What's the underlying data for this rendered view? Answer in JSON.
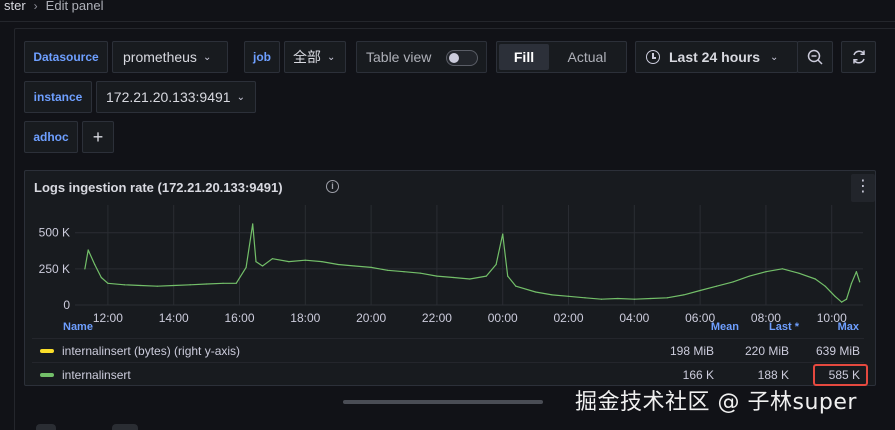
{
  "breadcrumb": {
    "parent": "ster",
    "separator": "›",
    "current": "Edit panel"
  },
  "variables": {
    "datasource": {
      "label": "Datasource",
      "value": "prometheus"
    },
    "job": {
      "label": "job",
      "value": "全部"
    },
    "instance": {
      "label": "instance",
      "value": "172.21.20.133:9491"
    },
    "adhoc": {
      "label": "adhoc",
      "add_symbol": "+"
    }
  },
  "toolbar": {
    "table_view_label": "Table view",
    "table_view_on": false,
    "fill_label": "Fill",
    "actual_label": "Actual",
    "time_range": "Last 24 hours",
    "zoom_icon": "zoom-out-icon",
    "refresh_icon": "refresh-icon"
  },
  "panel": {
    "title": "Logs ingestion rate (172.21.20.133:9491)",
    "menu_symbol": "⋮",
    "info_symbol": "i"
  },
  "chart_data": {
    "type": "line",
    "title": "Logs ingestion rate (172.21.20.133:9491)",
    "x_ticks": [
      "12:00",
      "14:00",
      "16:00",
      "18:00",
      "20:00",
      "22:00",
      "00:00",
      "02:00",
      "04:00",
      "06:00",
      "08:00",
      "10:00"
    ],
    "y_ticks": [
      "500 K",
      "250 K",
      "0"
    ],
    "ylim": [
      0,
      650000
    ],
    "grid": true,
    "series": [
      {
        "name": "internalinsert",
        "color": "#73bf69",
        "x_hours": [
          11.3,
          11.4,
          11.6,
          11.8,
          12.0,
          12.5,
          13.0,
          13.5,
          14.0,
          14.5,
          15.0,
          15.5,
          15.9,
          16.2,
          16.4,
          16.5,
          16.7,
          17.0,
          17.5,
          18.0,
          18.5,
          19.0,
          19.5,
          20.0,
          20.5,
          21.0,
          21.5,
          22.0,
          22.5,
          23.0,
          23.5,
          23.8,
          24.0,
          24.15,
          24.4,
          25.0,
          25.5,
          26.0,
          26.5,
          27.0,
          27.5,
          28.0,
          28.5,
          29.0,
          29.5,
          30.0,
          30.5,
          31.0,
          31.5,
          32.0,
          32.5,
          33.0,
          33.5,
          33.8,
          34.1,
          34.3,
          34.45,
          34.6,
          34.75,
          34.85
        ],
        "values": [
          250000,
          380000,
          280000,
          190000,
          150000,
          140000,
          135000,
          130000,
          135000,
          140000,
          145000,
          150000,
          150000,
          260000,
          560000,
          300000,
          270000,
          320000,
          300000,
          310000,
          300000,
          280000,
          270000,
          260000,
          240000,
          230000,
          220000,
          200000,
          190000,
          180000,
          200000,
          280000,
          490000,
          200000,
          130000,
          90000,
          70000,
          60000,
          50000,
          40000,
          45000,
          40000,
          45000,
          50000,
          70000,
          100000,
          130000,
          160000,
          200000,
          230000,
          250000,
          220000,
          180000,
          130000,
          60000,
          20000,
          40000,
          150000,
          230000,
          160000
        ]
      }
    ],
    "legend": {
      "columns": [
        "Name",
        "Mean",
        "Last *",
        "Max"
      ],
      "rows": [
        {
          "name": "internalinsert (bytes) (right y-axis)",
          "color": "#fade2a",
          "mean": "198 MiB",
          "last": "220 MiB",
          "max": "639 MiB"
        },
        {
          "name": "internalinsert",
          "color": "#73bf69",
          "mean": "166 K",
          "last": "188 K",
          "max": "585 K"
        }
      ]
    }
  },
  "watermark": "掘金技术社区 @ 子林super"
}
